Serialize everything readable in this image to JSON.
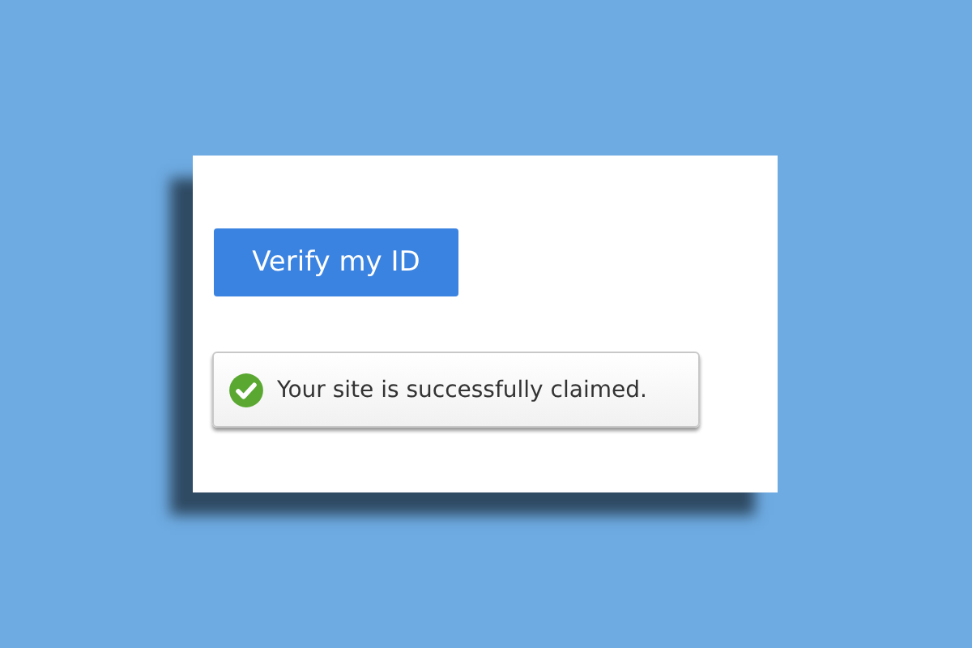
{
  "button": {
    "label": "Verify my ID"
  },
  "notice": {
    "kind": "success",
    "text": "Your site is successfully claimed."
  }
}
